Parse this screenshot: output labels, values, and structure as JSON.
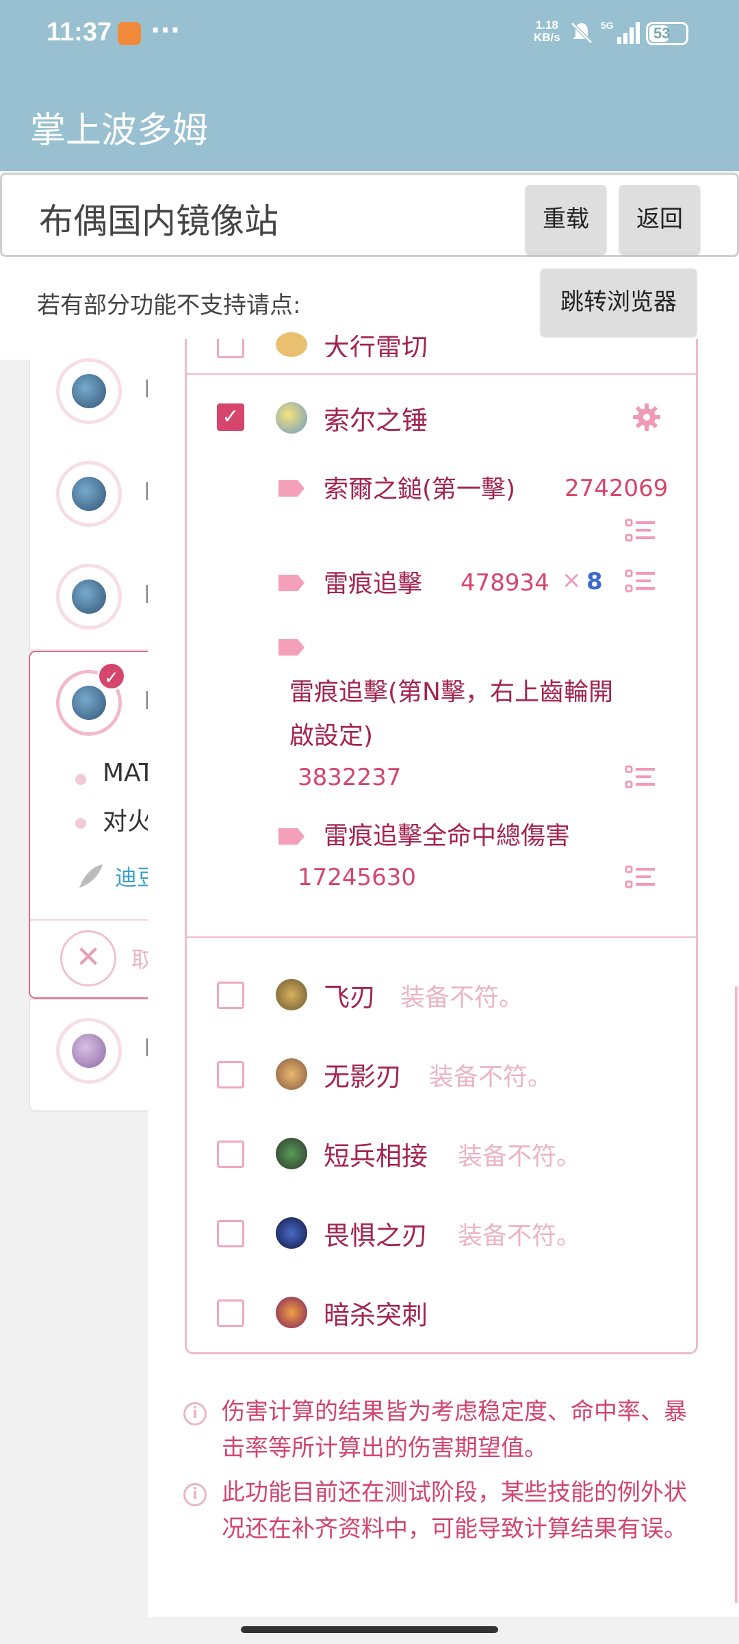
{
  "status_bar": {
    "time": "11:37",
    "net_speed_value": "1.18",
    "net_speed_unit": "KB/s",
    "network": "5G",
    "battery": "53"
  },
  "app": {
    "title": "掌上波多姆"
  },
  "mirror": {
    "title": "布偶国内镜像站",
    "reload_label": "重载",
    "back_label": "返回",
    "hint": "若有部分功能不支持请点:",
    "jump_label": "跳转浏览器"
  },
  "background_list": {
    "item_letter": "B",
    "selected_card": {
      "line1": "MAT",
      "line2": "对火",
      "link_text": "迪豆",
      "cancel_text": "取"
    }
  },
  "skills": {
    "top_partial": "大行雷切",
    "thor": {
      "name": "索尔之锤",
      "rows": [
        {
          "label": "索爾之鎚(第一擊)",
          "value": "2742069"
        },
        {
          "label": "雷痕追擊",
          "value": "478934",
          "times": "×",
          "count": "8"
        },
        {
          "label_line1": "雷痕追擊(第N擊，右上齒輪開",
          "label_line2": "啟設定)",
          "value": "3832237"
        },
        {
          "label": "雷痕追擊全命中總傷害",
          "value": "17245630"
        }
      ]
    },
    "others": [
      {
        "name": "飞刃",
        "note": "装备不符。"
      },
      {
        "name": "无影刃",
        "note": "装备不符。"
      },
      {
        "name": "短兵相接",
        "note": "装备不符。"
      },
      {
        "name": "畏惧之刃",
        "note": "装备不符。"
      },
      {
        "name": "暗杀突刺",
        "note": ""
      }
    ]
  },
  "notes": [
    "伤害计算的结果皆为考虑稳定度、命中率、暴击率等所计算出的伤害期望值。",
    "此功能目前还在测试阶段，某些技能的例外状况还在补齐资料中，可能导致计算结果有误。"
  ],
  "colors": {
    "accent": "#d6456b",
    "appbar": "#98c0d0",
    "text_pink": "#a32450"
  }
}
